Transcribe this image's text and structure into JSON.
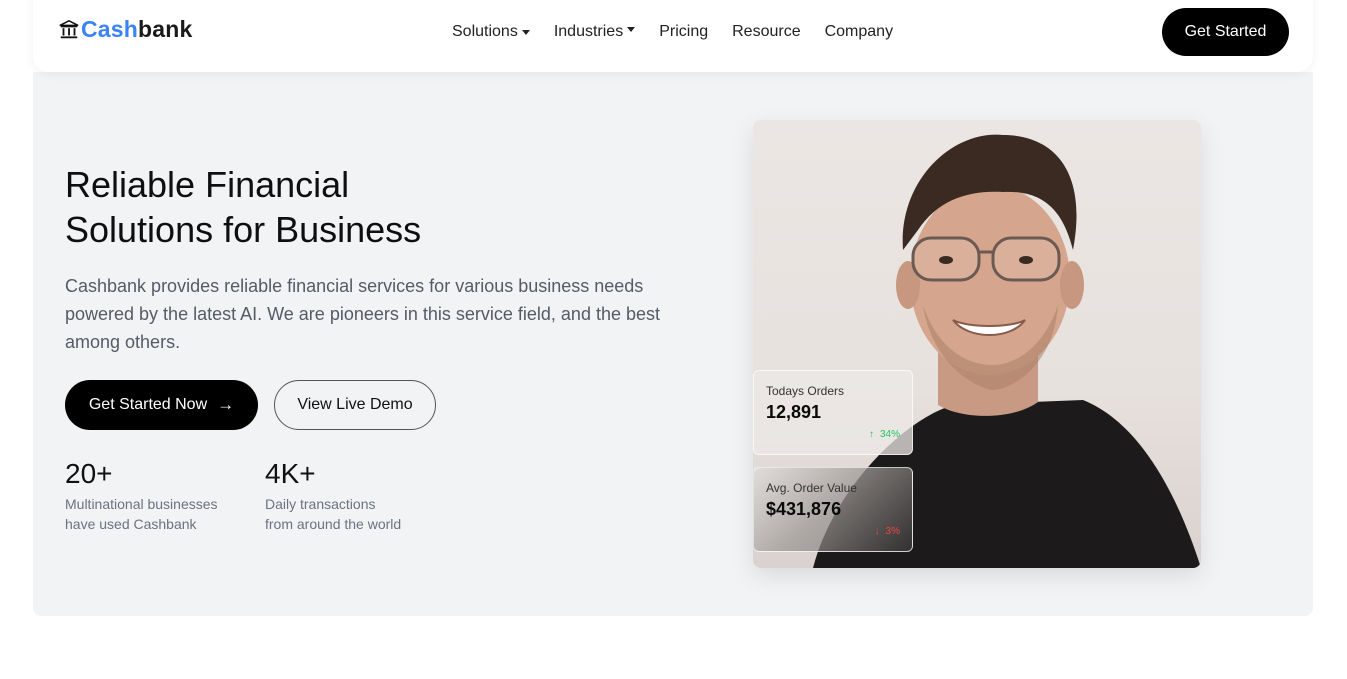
{
  "nav": {
    "brand_a": "Cash",
    "brand_b": "bank",
    "brand_icon": "bank-building-icon",
    "links": [
      {
        "label": "Solutions",
        "dropdown": true
      },
      {
        "label": "Industries",
        "dropdown": true
      },
      {
        "label": "Pricing",
        "dropdown": false
      },
      {
        "label": "Resource",
        "dropdown": false
      },
      {
        "label": "Company",
        "dropdown": false
      }
    ],
    "cta": "Get Started"
  },
  "hero": {
    "title_line1": "Reliable Financial",
    "title_line2": "Solutions for Business",
    "description": "Cashbank provides reliable financial services for various business needs powered by the latest AI. We are pioneers in this service field, and the best among others.",
    "primary_button": "Get Started Now",
    "primary_button_icon": "→",
    "secondary_button": "View Live Demo",
    "stats": [
      {
        "value": "20+",
        "label_line1": "Multinational businesses",
        "label_line2": "have used Cashbank"
      },
      {
        "value": "4K+",
        "label_line1": "Daily transactions",
        "label_line2": "from around the world"
      }
    ]
  },
  "cards": {
    "orders": {
      "label": "Todays Orders",
      "value": "12,891",
      "trend": "34%",
      "direction": "up",
      "arrow": "↑"
    },
    "avg_order": {
      "label": "Avg. Order Value",
      "value": "$431,876",
      "trend": "3%",
      "direction": "down",
      "arrow": "↓"
    }
  },
  "colors": {
    "accent": "#3b82f6",
    "primary": "#000000",
    "hero_bg": "#f2f3f5",
    "trend_up": "#22c55e",
    "trend_down": "#ef4444"
  }
}
